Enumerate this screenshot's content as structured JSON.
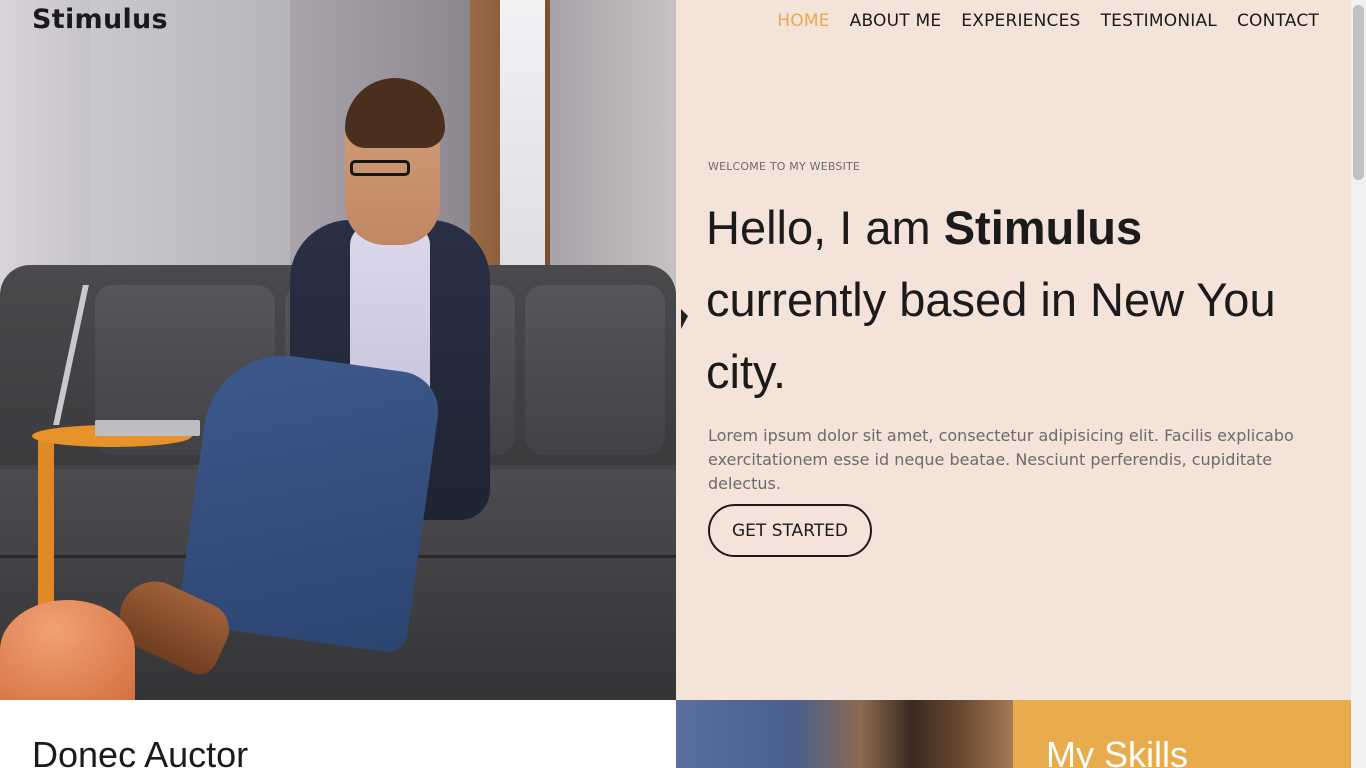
{
  "brand": "Stimulus",
  "nav": [
    {
      "label": "HOME",
      "active": true
    },
    {
      "label": "ABOUT ME",
      "active": false
    },
    {
      "label": "EXPERIENCES",
      "active": false
    },
    {
      "label": "TESTIMONIAL",
      "active": false
    },
    {
      "label": "CONTACT",
      "active": false
    }
  ],
  "hero": {
    "eyebrow": "WELCOME TO MY WEBSITE",
    "headline_prefix": "Hello, I am ",
    "headline_name": "Stimulus",
    "headline_suffix": " currently based in New You city.",
    "lede": "Lorem ipsum dolor sit amet, consectetur adipisicing elit. Facilis explicabo exercitationem esse id neque beatae. Nesciunt perferendis, cupiditate delectus.",
    "cta_label": "GET STARTED"
  },
  "sections": {
    "left_title": "Donec Auctor",
    "skills_title": "My Skills"
  },
  "colors": {
    "accent": "#e8a94a",
    "hero_panel_bg": "#f4e3d9",
    "skills_bg": "#e8ac4c"
  }
}
